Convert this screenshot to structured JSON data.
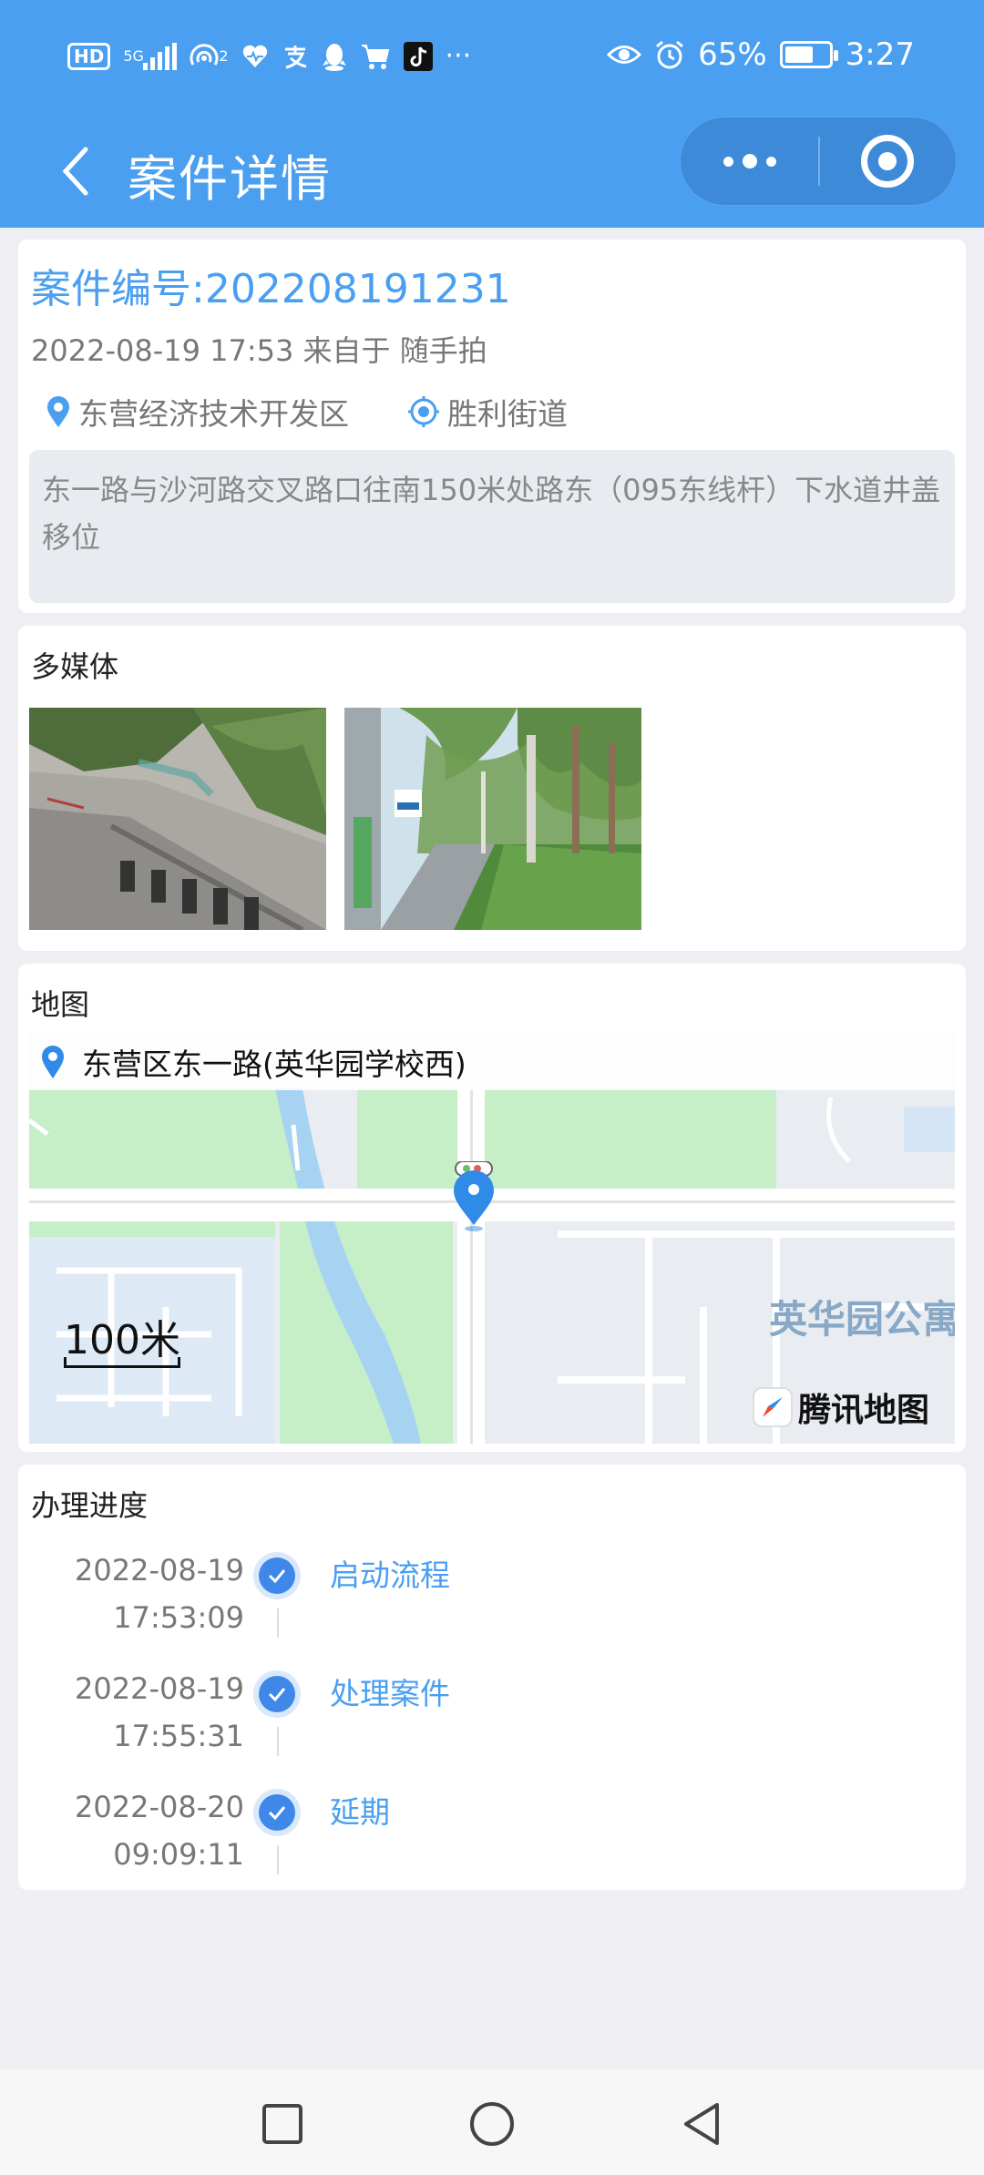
{
  "status_bar": {
    "network_badge": "HD",
    "signal_type": "5G",
    "hotspot_count": "2",
    "more": "···",
    "battery": "65%",
    "battery_level": 0.65,
    "time": "3:27"
  },
  "header": {
    "title": "案件详情"
  },
  "case": {
    "number_label": "案件编号:202208191231",
    "meta": "2022-08-19 17:53 来自于 随手拍",
    "district": "东营经济技术开发区",
    "street": "胜利街道",
    "description": "东一路与沙河路交叉路口往南150米处路东（095东线杆）下水道井盖移位"
  },
  "multimedia": {
    "title": "多媒体"
  },
  "map": {
    "title": "地图",
    "address": "东营区东一路(英华园学校西)",
    "scale": "100米",
    "place_label": "英华园公寓",
    "watermark": "腾讯地图"
  },
  "progress": {
    "title": "办理进度",
    "steps": [
      {
        "date": "2022-08-19",
        "time": "17:53:09",
        "label": "启动流程"
      },
      {
        "date": "2022-08-19",
        "time": "17:55:31",
        "label": "处理案件"
      },
      {
        "date": "2022-08-20",
        "time": "09:09:11",
        "label": "延期"
      }
    ]
  },
  "colors": {
    "primary": "#4a9ff1",
    "header_bg": "#4a9ff1",
    "page_bg": "#efeff3",
    "step_check": "#3f87e8"
  }
}
